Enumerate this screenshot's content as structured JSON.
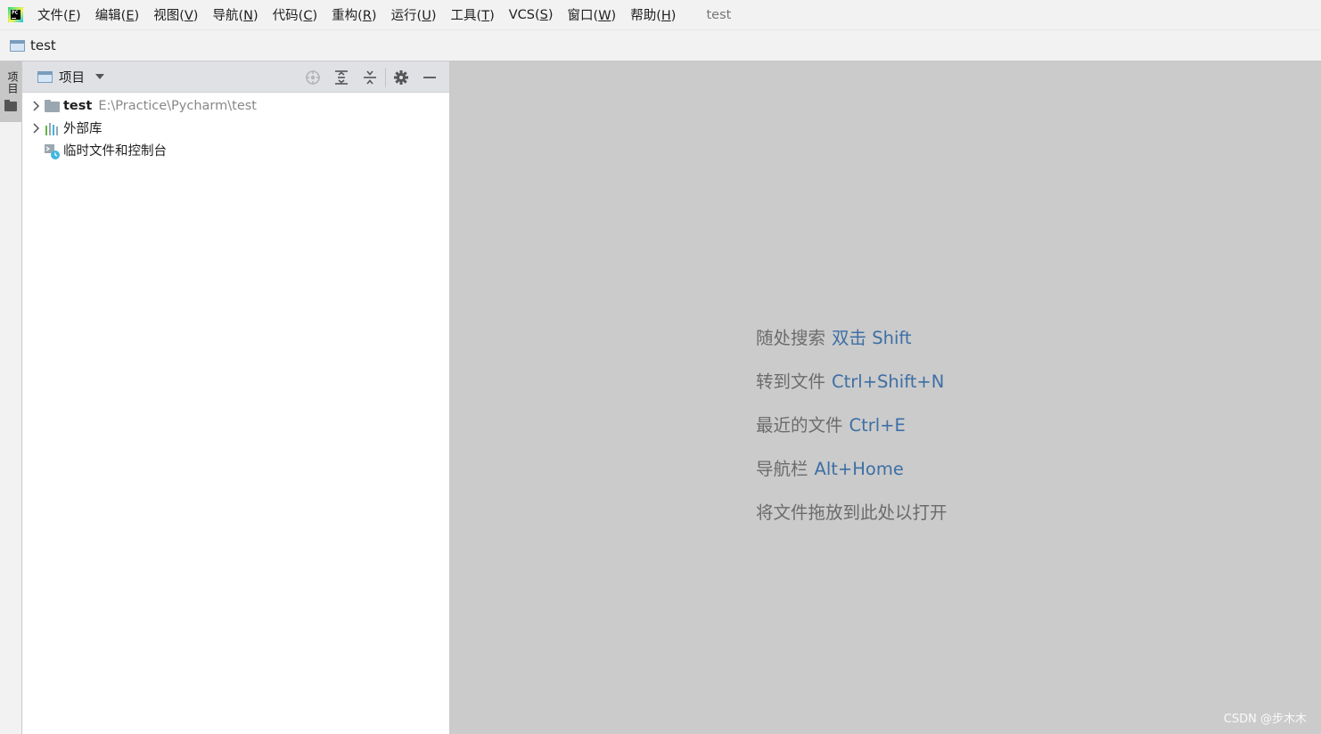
{
  "menubar": {
    "items": [
      {
        "label": "文件(",
        "mn": "F",
        "end": ")"
      },
      {
        "label": "编辑(",
        "mn": "E",
        "end": ")"
      },
      {
        "label": "视图(",
        "mn": "V",
        "end": ")"
      },
      {
        "label": "导航(",
        "mn": "N",
        "end": ")"
      },
      {
        "label": "代码(",
        "mn": "C",
        "end": ")"
      },
      {
        "label": "重构(",
        "mn": "R",
        "end": ")"
      },
      {
        "label": "运行(",
        "mn": "U",
        "end": ")"
      },
      {
        "label": "工具(",
        "mn": "T",
        "end": ")"
      },
      {
        "label": "VCS(",
        "mn": "S",
        "end": ")"
      },
      {
        "label": "窗口(",
        "mn": "W",
        "end": ")"
      },
      {
        "label": "帮助(",
        "mn": "H",
        "end": ")"
      }
    ],
    "window_title": "test"
  },
  "navbar": {
    "project_name": "test"
  },
  "toolstrip": {
    "project_tab_label": "项目"
  },
  "project_panel": {
    "title": "项目",
    "tree": {
      "root": {
        "name": "test",
        "path": "E:\\Practice\\Pycharm\\test"
      },
      "external_libraries": "外部库",
      "scratches": "临时文件和控制台"
    }
  },
  "editor": {
    "hints": [
      {
        "text": "随处搜索",
        "key": "双击 Shift"
      },
      {
        "text": "转到文件",
        "key": "Ctrl+Shift+N"
      },
      {
        "text": "最近的文件",
        "key": "Ctrl+E"
      },
      {
        "text": "导航栏",
        "key": "Alt+Home"
      },
      {
        "text": "将文件拖放到此处以打开",
        "key": ""
      }
    ]
  },
  "watermark": "CSDN @步木木"
}
